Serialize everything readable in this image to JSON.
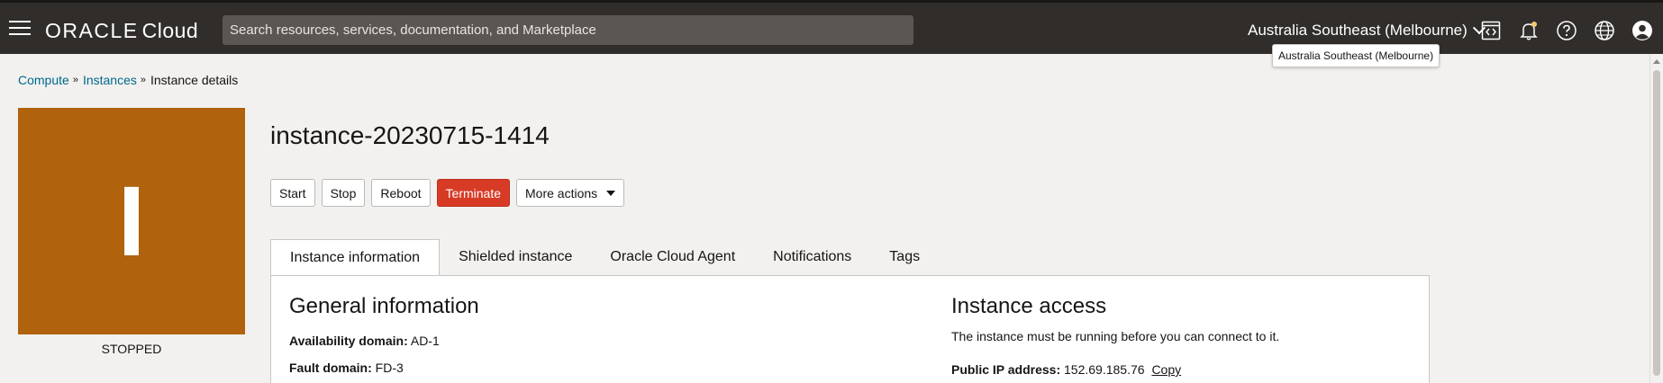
{
  "header": {
    "brand_oracle": "ORACLE",
    "brand_cloud": "Cloud",
    "search_placeholder": "Search resources, services, documentation, and Marketplace",
    "region": "Australia Southeast (Melbourne)",
    "region_tooltip": "Australia Southeast (Melbourne)",
    "icons": [
      "menu-icon",
      "code-editor-icon",
      "bell-icon",
      "help-icon",
      "globe-icon",
      "user-icon"
    ]
  },
  "breadcrumb": {
    "items": [
      "Compute",
      "Instances",
      "Instance details"
    ],
    "separator": "»"
  },
  "instance": {
    "avatar_letter": "I",
    "avatar_color": "#b0620c",
    "status": "STOPPED",
    "name": "instance-20230715-1414"
  },
  "actions": {
    "start": "Start",
    "stop": "Stop",
    "reboot": "Reboot",
    "terminate": "Terminate",
    "more": "More actions"
  },
  "tabs": [
    "Instance information",
    "Shielded instance",
    "Oracle Cloud Agent",
    "Notifications",
    "Tags"
  ],
  "general": {
    "title": "General information",
    "availability_label": "Availability domain:",
    "availability_value": "AD-1",
    "fault_label": "Fault domain:",
    "fault_value": "FD-3"
  },
  "access": {
    "title": "Instance access",
    "note": "The instance must be running before you can connect to it.",
    "ip_label": "Public IP address:",
    "ip_value": "152.69.185.76",
    "copy": "Copy"
  },
  "colors": {
    "topbar": "#312d2a",
    "link": "#00688c",
    "danger": "#d73a25"
  }
}
